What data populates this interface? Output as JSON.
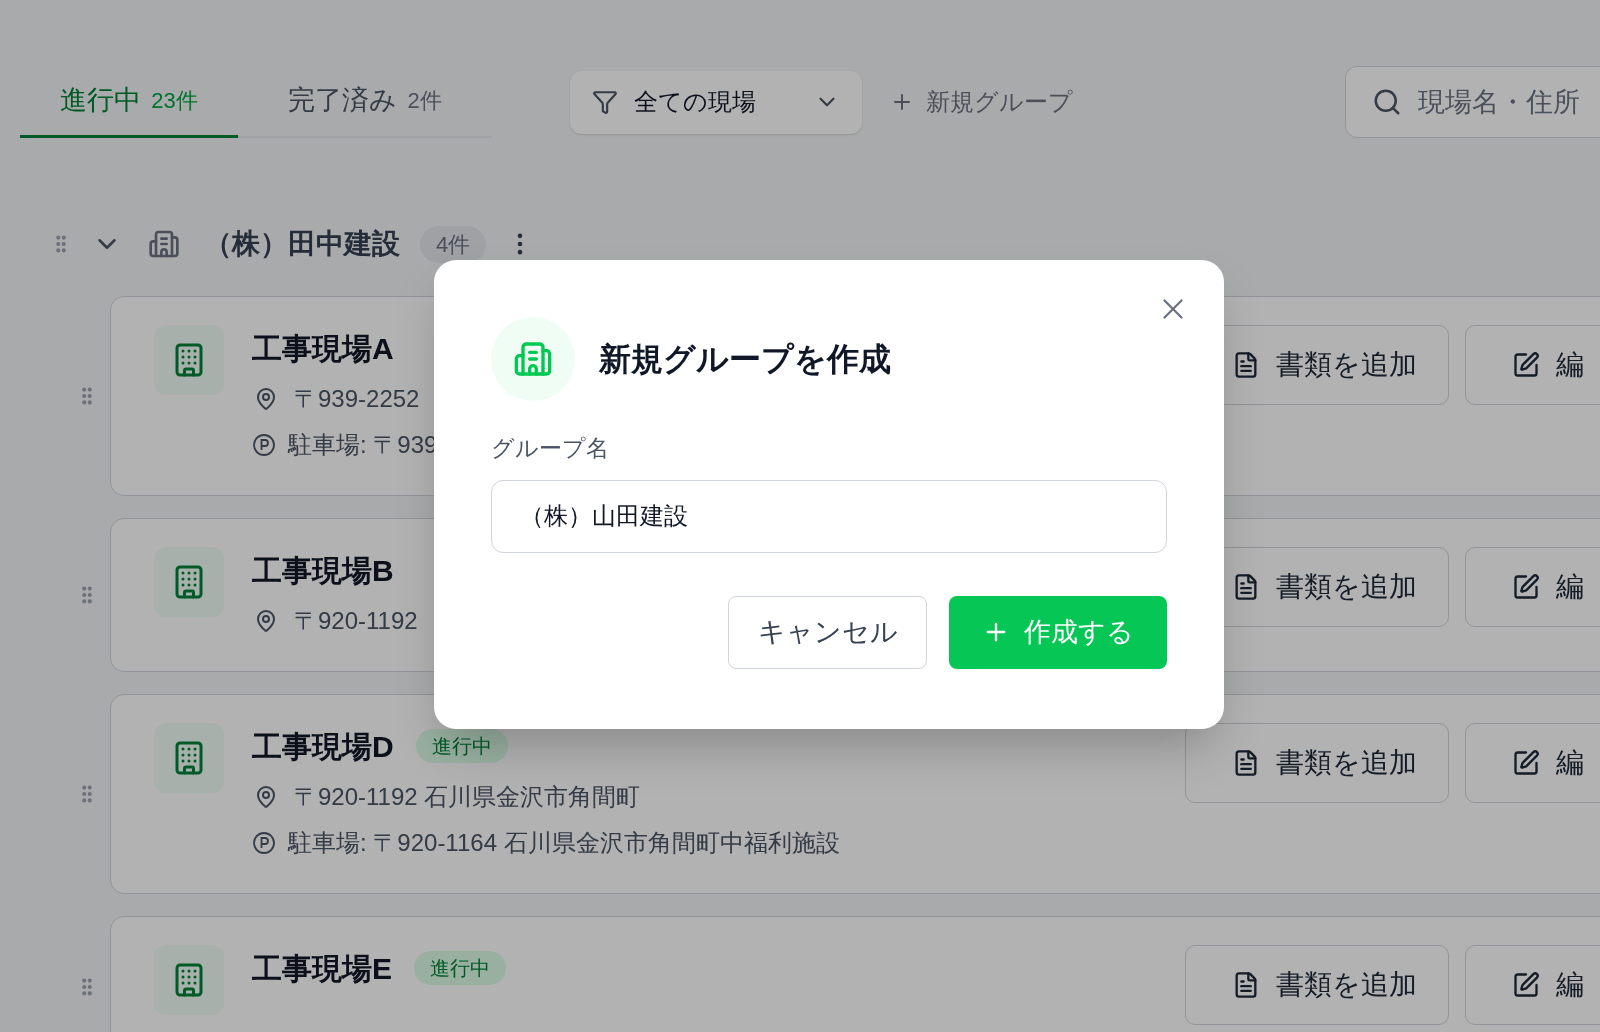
{
  "tabs": [
    {
      "label": "進行中",
      "count": "23件",
      "selected": true
    },
    {
      "label": "完了済み",
      "count": "2件",
      "selected": false
    }
  ],
  "filter": {
    "label": "全ての現場"
  },
  "new_group": {
    "label": "新規グループ"
  },
  "search": {
    "placeholder": "現場名・住所"
  },
  "groups": [
    {
      "name": "（株）田中建設",
      "count": "4件",
      "expanded": true,
      "sites": [
        {
          "name": "工事現場A",
          "address": "〒939-2252",
          "parking": "駐車場: 〒939",
          "actions": [
            "書類を追加",
            "編"
          ]
        },
        {
          "name": "工事現場B",
          "address": "〒920-1192",
          "actions": [
            "書類を追加",
            "編"
          ]
        },
        {
          "name": "工事現場D",
          "status": "進行中",
          "address": "〒920-1192 石川県金沢市角間町",
          "parking": "駐車場: 〒920-1164 石川県金沢市角間町中福利施設",
          "actions": [
            "書類を追加",
            "編"
          ]
        },
        {
          "name": "工事現場E",
          "status": "進行中",
          "actions": [
            "書類を追加",
            "編"
          ]
        }
      ]
    }
  ],
  "modal": {
    "title": "新規グループを作成",
    "field_label": "グループ名",
    "field_value": "（株）山田建設",
    "buttons": [
      {
        "label": "キャンセル",
        "kind": "secondary"
      },
      {
        "label": "作成する",
        "kind": "primary"
      }
    ]
  }
}
